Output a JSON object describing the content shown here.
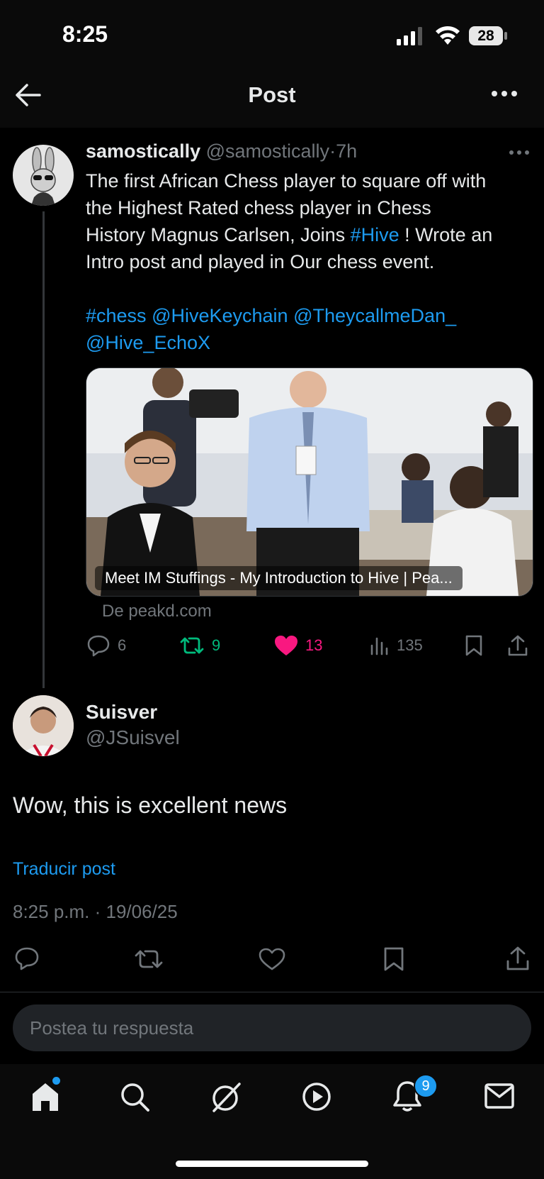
{
  "status_bar": {
    "time": "8:25",
    "battery": "28"
  },
  "header": {
    "title": "Post"
  },
  "parent_post": {
    "display_name": "samostically",
    "handle": "@samostically",
    "separator": "·",
    "time_ago": "7h",
    "text_line1": "The first African Chess player to square off with",
    "text_line2": "the Highest Rated chess player in Chess",
    "text_line3_a": "History Magnus Carlsen, Joins ",
    "text_line3_link": "#Hive",
    "text_line3_b": " ! Wrote an",
    "text_line4": "Intro post and played in Our chess event.",
    "tags_line1_a": "#chess",
    "tags_line1_b": "@HiveKeychain",
    "tags_line1_c": "@TheycallmeDan_",
    "tags_line2": "@Hive_EchoX",
    "card_caption": "Meet IM Stuffings - My Introduction to Hive | Pea...",
    "card_source": "De peakd.com",
    "replies": "6",
    "reposts": "9",
    "likes": "13",
    "views": "135",
    "colors": {
      "repost": "#00ba7c",
      "like": "#f91880",
      "link": "#1d9bf0"
    }
  },
  "main_post": {
    "display_name": "Suisver",
    "handle": "@JSuisvel",
    "text": "Wow, this is excellent news",
    "translate": "Traducir post",
    "timestamp": "8:25 p.m. · 19/06/25"
  },
  "reply": {
    "placeholder": "Postea tu respuesta"
  },
  "nav": {
    "items": [
      "home-icon",
      "search-icon",
      "grok-icon",
      "video-icon",
      "bell-icon",
      "mail-icon"
    ],
    "notifications_badge": "9"
  }
}
